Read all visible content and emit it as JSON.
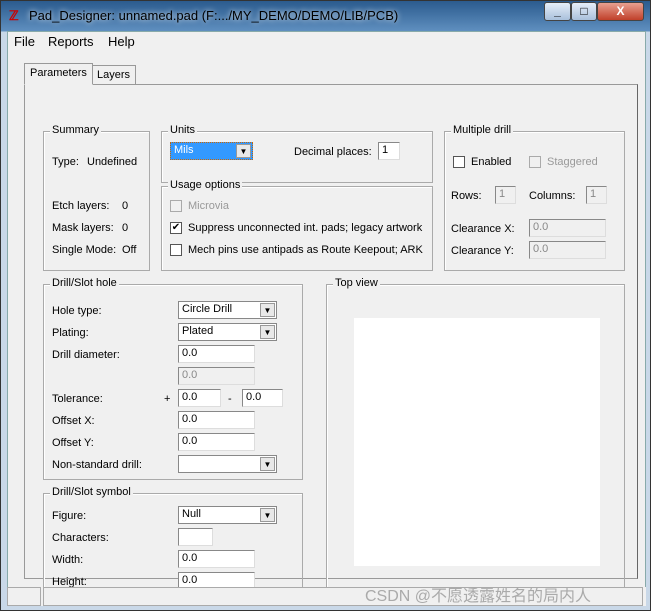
{
  "window": {
    "title": "Pad_Designer: unnamed.pad (F:.../MY_DEMO/DEMO/LIB/PCB)",
    "minimize": "_",
    "maximize": "□",
    "close": "X"
  },
  "menu": [
    "File",
    "Reports",
    "Help"
  ],
  "tabs": [
    "Parameters",
    "Layers"
  ],
  "summary": {
    "label": "Summary",
    "type_label": "Type:",
    "type_value": "Undefined",
    "etch_label": "Etch layers:",
    "etch_value": "0",
    "mask_label": "Mask layers:",
    "mask_value": "0",
    "single_label": "Single Mode:",
    "single_value": "Off"
  },
  "units": {
    "label": "Units",
    "value": "Mils",
    "decimal_label": "Decimal places:",
    "decimal_value": "1"
  },
  "usage": {
    "label": "Usage options",
    "microvia": "Microvia",
    "suppress": "Suppress unconnected int. pads; legacy artwork",
    "suppress_checked": true,
    "mech": "Mech pins use antipads as Route Keepout; ARK"
  },
  "multiple_drill": {
    "label": "Multiple drill",
    "enabled": "Enabled",
    "staggered": "Staggered",
    "rows_label": "Rows:",
    "rows": "1",
    "cols_label": "Columns:",
    "cols": "1",
    "clrx_label": "Clearance X:",
    "clrx": "0.0",
    "clry_label": "Clearance Y:",
    "clry": "0.0"
  },
  "drill": {
    "label": "Drill/Slot hole",
    "hole_type_label": "Hole type:",
    "hole_type": "Circle Drill",
    "plating_label": "Plating:",
    "plating": "Plated",
    "diameter_label": "Drill diameter:",
    "diameter": "0.0",
    "diameter2": "0.0",
    "tol_label": "Tolerance:",
    "plus": "+",
    "tol_plus": "0.0",
    "minus": "-",
    "tol_minus": "0.0",
    "offx_label": "Offset X:",
    "offx": "0.0",
    "offy_label": "Offset Y:",
    "offy": "0.0",
    "nonstd_label": "Non-standard drill:",
    "nonstd": ""
  },
  "symbol": {
    "label": "Drill/Slot symbol",
    "figure_label": "Figure:",
    "figure": "Null",
    "chars_label": "Characters:",
    "chars": "",
    "width_label": "Width:",
    "width": "0.0",
    "height_label": "Height:",
    "height": "0.0"
  },
  "top_view": {
    "label": "Top view"
  },
  "watermark": "CSDN @不愿透露姓名的局内人"
}
